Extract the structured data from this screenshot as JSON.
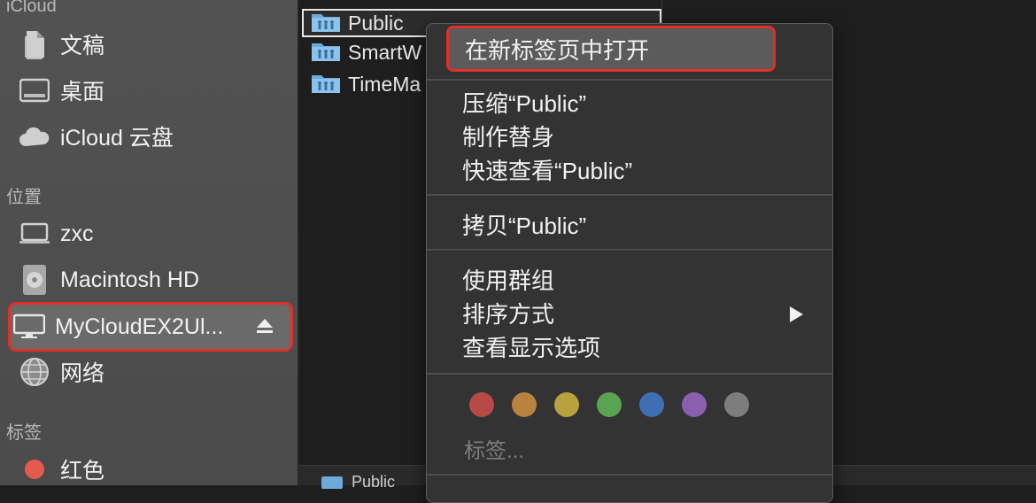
{
  "sidebar": {
    "sections": [
      {
        "title": "iCloud"
      },
      {
        "title": "位置"
      },
      {
        "title": "标签"
      }
    ],
    "icloud_items": [
      {
        "label": "文稿",
        "icon": "document-icon"
      },
      {
        "label": "桌面",
        "icon": "desktop-icon"
      },
      {
        "label": "iCloud 云盘",
        "icon": "cloud-icon"
      }
    ],
    "location_items": [
      {
        "label": "zxc",
        "icon": "laptop-icon"
      },
      {
        "label": "Macintosh HD",
        "icon": "hard-drive-icon"
      },
      {
        "label": "MyCloudEX2Ul...",
        "icon": "monitor-icon",
        "selected": true
      },
      {
        "label": "网络",
        "icon": "network-globe-icon"
      }
    ],
    "tag_items": [
      {
        "label": "红色",
        "color": "#e55a4f"
      }
    ]
  },
  "files": [
    {
      "name": "Public",
      "active": true
    },
    {
      "name": "SmartW"
    },
    {
      "name": "TimeMa"
    }
  ],
  "path_bar": {
    "label": "Public"
  },
  "context_menu": {
    "open_new_tab": "在新标签页中打开",
    "compress": "压缩“Public”",
    "make_alias": "制作替身",
    "quick_look": "快速查看“Public”",
    "copy": "拷贝“Public”",
    "use_groups": "使用群组",
    "sort_by": "排序方式",
    "show_view_options": "查看显示选项",
    "tags_label": "标签...",
    "tag_colors": [
      "#b84a46",
      "#b9823f",
      "#b7a23e",
      "#59a351",
      "#3f6fb3",
      "#8a5fb0",
      "#7d7d7d"
    ]
  },
  "accent": {
    "highlight_outline": "#e0302a"
  }
}
